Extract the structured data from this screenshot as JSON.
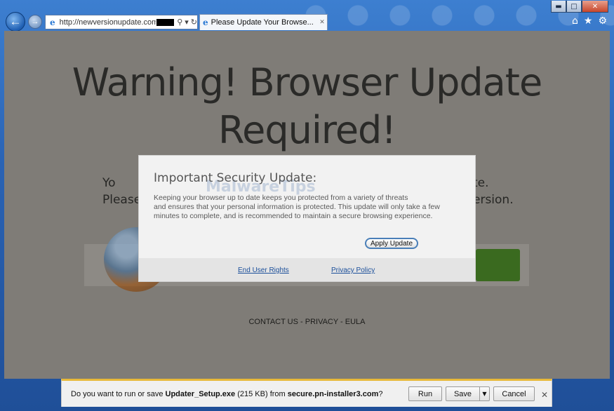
{
  "window": {
    "minimize_glyph": "▬",
    "maximize_glyph": "□",
    "close_glyph": "✕"
  },
  "nav": {
    "back_glyph": "←",
    "forward_glyph": "→",
    "address_url": "http://newversionupdate.com",
    "search_glyph": "⚲",
    "dropdown_glyph": "▾",
    "refresh_glyph": "↻",
    "ie_glyph": "e"
  },
  "tab": {
    "title": "Please Update Your Browse...",
    "close_glyph": "✕"
  },
  "toolbar": {
    "home_glyph": "⌂",
    "favorites_glyph": "★",
    "settings_glyph": "⚙"
  },
  "page": {
    "headline_line1": "Warning! Browser Update",
    "headline_line2": "Required!",
    "partial_left_1": "Yo",
    "partial_left_2": "Please",
    "partial_right_1": "te.",
    "partial_right_2": "ersion.",
    "footer_links": "CONTACT US - PRIVACY - EULA"
  },
  "modal": {
    "title": "Important Security Update:",
    "body_line1": "Keeping your browser up to date keeps you protected from a variety of threats",
    "body_line2": "and ensures that your personal information is protected. This update will only take a few",
    "body_line3": "minutes to complete, and is recommended to maintain a secure browsing experience.",
    "watermark": "MalwareTips",
    "apply_button": "Apply Update",
    "link_eula": "End User Rights",
    "link_privacy": "Privacy Policy"
  },
  "download_bar": {
    "prefix": "Do you want to run or save ",
    "filename": "Updater_Setup.exe",
    "size": " (215 KB) from ",
    "source": "secure.pn-installer3.com",
    "suffix": "?",
    "run_label": "Run",
    "save_label": "Save",
    "dropdown_glyph": "▼",
    "cancel_label": "Cancel",
    "close_glyph": "✕"
  },
  "colors": {
    "content_overlay": "#7f7c77",
    "notification_accent": "#e8b93a",
    "link": "#1b4f9a"
  }
}
